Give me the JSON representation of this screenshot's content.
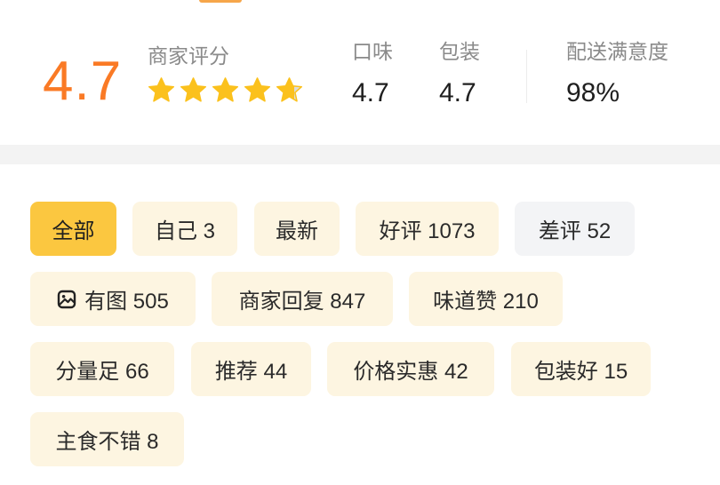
{
  "rating": {
    "score": "4.7",
    "label": "商家评分",
    "stars": {
      "filled": 4,
      "partial": 0.7,
      "total": 5
    },
    "metrics": [
      {
        "label": "口味",
        "value": "4.7"
      },
      {
        "label": "包装",
        "value": "4.7"
      },
      {
        "label": "配送满意度",
        "value": "98%"
      }
    ]
  },
  "tags": [
    {
      "label": "全部",
      "active": true
    },
    {
      "label": "自己 3"
    },
    {
      "label": "最新"
    },
    {
      "label": "好评 1073"
    },
    {
      "label": "差评 52",
      "negative": true
    },
    {
      "label": "有图 505",
      "icon": "image-icon"
    },
    {
      "label": "商家回复 847"
    },
    {
      "label": "味道赞 210"
    },
    {
      "label": "分量足 66"
    },
    {
      "label": "推荐 44"
    },
    {
      "label": "价格实惠 42"
    },
    {
      "label": "包装好 15"
    },
    {
      "label": "主食不错 8"
    }
  ],
  "colors": {
    "score": "#fa7a25",
    "star": "#fbc11d",
    "active_tag": "#fbc740",
    "tag_bg": "#fdf5e1",
    "negative_tag_bg": "#f3f4f6"
  }
}
